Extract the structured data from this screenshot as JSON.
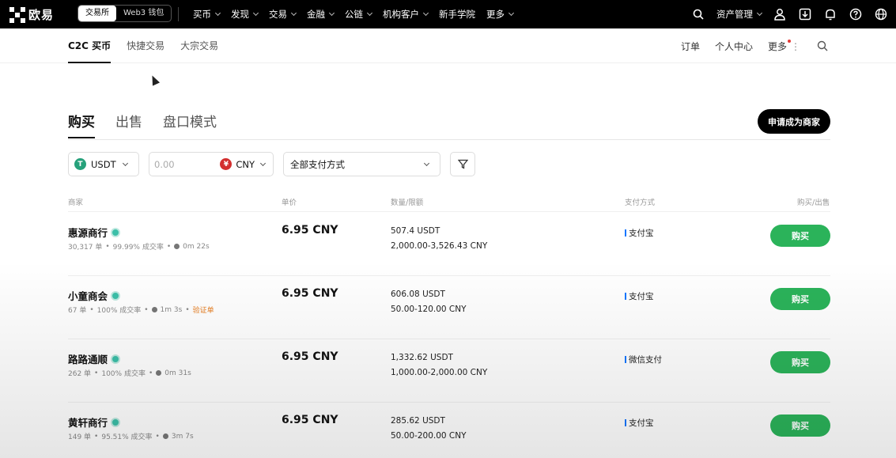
{
  "topbar": {
    "logo_text": "欧易",
    "switch": [
      "交易所",
      "Web3 钱包"
    ],
    "nav": [
      "买币",
      "发现",
      "交易",
      "金融",
      "公链",
      "机构客户",
      "新手学院",
      "更多"
    ],
    "asset_label": "资产管理"
  },
  "subnav": {
    "tabs": [
      "C2C 买币",
      "快捷交易",
      "大宗交易"
    ],
    "right": [
      "订单",
      "个人中心",
      "更多"
    ]
  },
  "mode": {
    "tabs": [
      "购买",
      "出售",
      "盘口模式"
    ],
    "merchant_button": "申请成为商家"
  },
  "filters": {
    "coin": "USDT",
    "amount_placeholder": "0.00",
    "fiat": "CNY",
    "payment": "全部支付方式"
  },
  "table": {
    "headers": [
      "商家",
      "单价",
      "数量/限额",
      "支付方式",
      "购买/出售"
    ],
    "rows": [
      {
        "name": "惠源商行",
        "orders": "30,317 单",
        "rate": "99.99% 成交率",
        "time": "0m 22s",
        "extra": "",
        "price": "6.95 CNY",
        "qty": "507.4 USDT",
        "limit": "2,000.00-3,526.43 CNY",
        "pay": "支付宝",
        "action": "购买"
      },
      {
        "name": "小童商会",
        "orders": "67 单",
        "rate": "100% 成交率",
        "time": "1m 3s",
        "extra": "验证单",
        "price": "6.95 CNY",
        "qty": "606.08 USDT",
        "limit": "50.00-120.00 CNY",
        "pay": "支付宝",
        "action": "购买"
      },
      {
        "name": "路路通顺",
        "orders": "262 单",
        "rate": "100% 成交率",
        "time": "0m 31s",
        "extra": "",
        "price": "6.95 CNY",
        "qty": "1,332.62 USDT",
        "limit": "1,000.00-2,000.00 CNY",
        "pay": "微信支付",
        "action": "购买"
      },
      {
        "name": "黄轩商行",
        "orders": "149 单",
        "rate": "95.51% 成交率",
        "time": "3m 7s",
        "extra": "",
        "price": "6.95 CNY",
        "qty": "285.62 USDT",
        "limit": "50.00-200.00 CNY",
        "pay": "支付宝",
        "action": "购买"
      }
    ]
  }
}
